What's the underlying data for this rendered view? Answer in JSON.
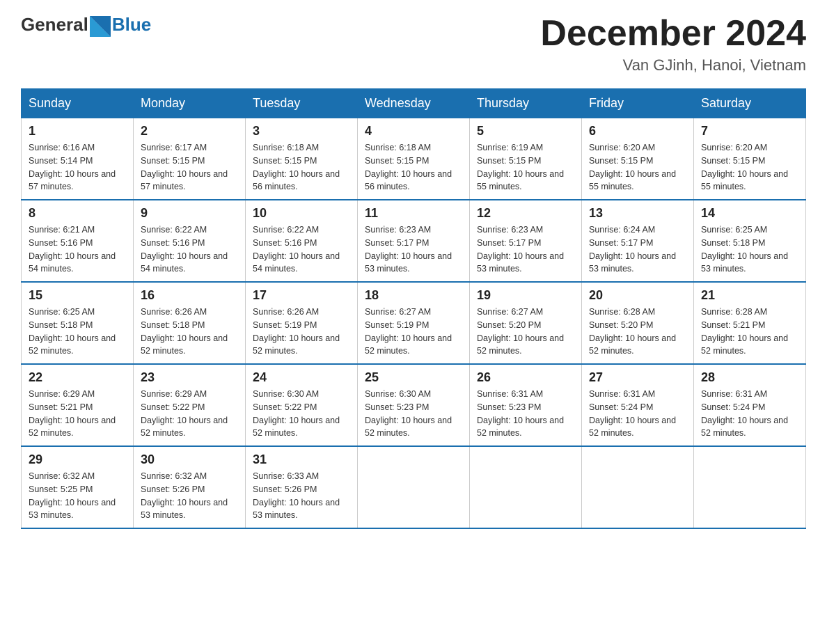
{
  "header": {
    "logo_general": "General",
    "logo_blue": "Blue",
    "month_title": "December 2024",
    "location": "Van GJinh, Hanoi, Vietnam"
  },
  "weekdays": [
    "Sunday",
    "Monday",
    "Tuesday",
    "Wednesday",
    "Thursday",
    "Friday",
    "Saturday"
  ],
  "weeks": [
    [
      {
        "day": "1",
        "sunrise": "6:16 AM",
        "sunset": "5:14 PM",
        "daylight": "10 hours and 57 minutes."
      },
      {
        "day": "2",
        "sunrise": "6:17 AM",
        "sunset": "5:15 PM",
        "daylight": "10 hours and 57 minutes."
      },
      {
        "day": "3",
        "sunrise": "6:18 AM",
        "sunset": "5:15 PM",
        "daylight": "10 hours and 56 minutes."
      },
      {
        "day": "4",
        "sunrise": "6:18 AM",
        "sunset": "5:15 PM",
        "daylight": "10 hours and 56 minutes."
      },
      {
        "day": "5",
        "sunrise": "6:19 AM",
        "sunset": "5:15 PM",
        "daylight": "10 hours and 55 minutes."
      },
      {
        "day": "6",
        "sunrise": "6:20 AM",
        "sunset": "5:15 PM",
        "daylight": "10 hours and 55 minutes."
      },
      {
        "day": "7",
        "sunrise": "6:20 AM",
        "sunset": "5:15 PM",
        "daylight": "10 hours and 55 minutes."
      }
    ],
    [
      {
        "day": "8",
        "sunrise": "6:21 AM",
        "sunset": "5:16 PM",
        "daylight": "10 hours and 54 minutes."
      },
      {
        "day": "9",
        "sunrise": "6:22 AM",
        "sunset": "5:16 PM",
        "daylight": "10 hours and 54 minutes."
      },
      {
        "day": "10",
        "sunrise": "6:22 AM",
        "sunset": "5:16 PM",
        "daylight": "10 hours and 54 minutes."
      },
      {
        "day": "11",
        "sunrise": "6:23 AM",
        "sunset": "5:17 PM",
        "daylight": "10 hours and 53 minutes."
      },
      {
        "day": "12",
        "sunrise": "6:23 AM",
        "sunset": "5:17 PM",
        "daylight": "10 hours and 53 minutes."
      },
      {
        "day": "13",
        "sunrise": "6:24 AM",
        "sunset": "5:17 PM",
        "daylight": "10 hours and 53 minutes."
      },
      {
        "day": "14",
        "sunrise": "6:25 AM",
        "sunset": "5:18 PM",
        "daylight": "10 hours and 53 minutes."
      }
    ],
    [
      {
        "day": "15",
        "sunrise": "6:25 AM",
        "sunset": "5:18 PM",
        "daylight": "10 hours and 52 minutes."
      },
      {
        "day": "16",
        "sunrise": "6:26 AM",
        "sunset": "5:18 PM",
        "daylight": "10 hours and 52 minutes."
      },
      {
        "day": "17",
        "sunrise": "6:26 AM",
        "sunset": "5:19 PM",
        "daylight": "10 hours and 52 minutes."
      },
      {
        "day": "18",
        "sunrise": "6:27 AM",
        "sunset": "5:19 PM",
        "daylight": "10 hours and 52 minutes."
      },
      {
        "day": "19",
        "sunrise": "6:27 AM",
        "sunset": "5:20 PM",
        "daylight": "10 hours and 52 minutes."
      },
      {
        "day": "20",
        "sunrise": "6:28 AM",
        "sunset": "5:20 PM",
        "daylight": "10 hours and 52 minutes."
      },
      {
        "day": "21",
        "sunrise": "6:28 AM",
        "sunset": "5:21 PM",
        "daylight": "10 hours and 52 minutes."
      }
    ],
    [
      {
        "day": "22",
        "sunrise": "6:29 AM",
        "sunset": "5:21 PM",
        "daylight": "10 hours and 52 minutes."
      },
      {
        "day": "23",
        "sunrise": "6:29 AM",
        "sunset": "5:22 PM",
        "daylight": "10 hours and 52 minutes."
      },
      {
        "day": "24",
        "sunrise": "6:30 AM",
        "sunset": "5:22 PM",
        "daylight": "10 hours and 52 minutes."
      },
      {
        "day": "25",
        "sunrise": "6:30 AM",
        "sunset": "5:23 PM",
        "daylight": "10 hours and 52 minutes."
      },
      {
        "day": "26",
        "sunrise": "6:31 AM",
        "sunset": "5:23 PM",
        "daylight": "10 hours and 52 minutes."
      },
      {
        "day": "27",
        "sunrise": "6:31 AM",
        "sunset": "5:24 PM",
        "daylight": "10 hours and 52 minutes."
      },
      {
        "day": "28",
        "sunrise": "6:31 AM",
        "sunset": "5:24 PM",
        "daylight": "10 hours and 52 minutes."
      }
    ],
    [
      {
        "day": "29",
        "sunrise": "6:32 AM",
        "sunset": "5:25 PM",
        "daylight": "10 hours and 53 minutes."
      },
      {
        "day": "30",
        "sunrise": "6:32 AM",
        "sunset": "5:26 PM",
        "daylight": "10 hours and 53 minutes."
      },
      {
        "day": "31",
        "sunrise": "6:33 AM",
        "sunset": "5:26 PM",
        "daylight": "10 hours and 53 minutes."
      },
      null,
      null,
      null,
      null
    ]
  ]
}
